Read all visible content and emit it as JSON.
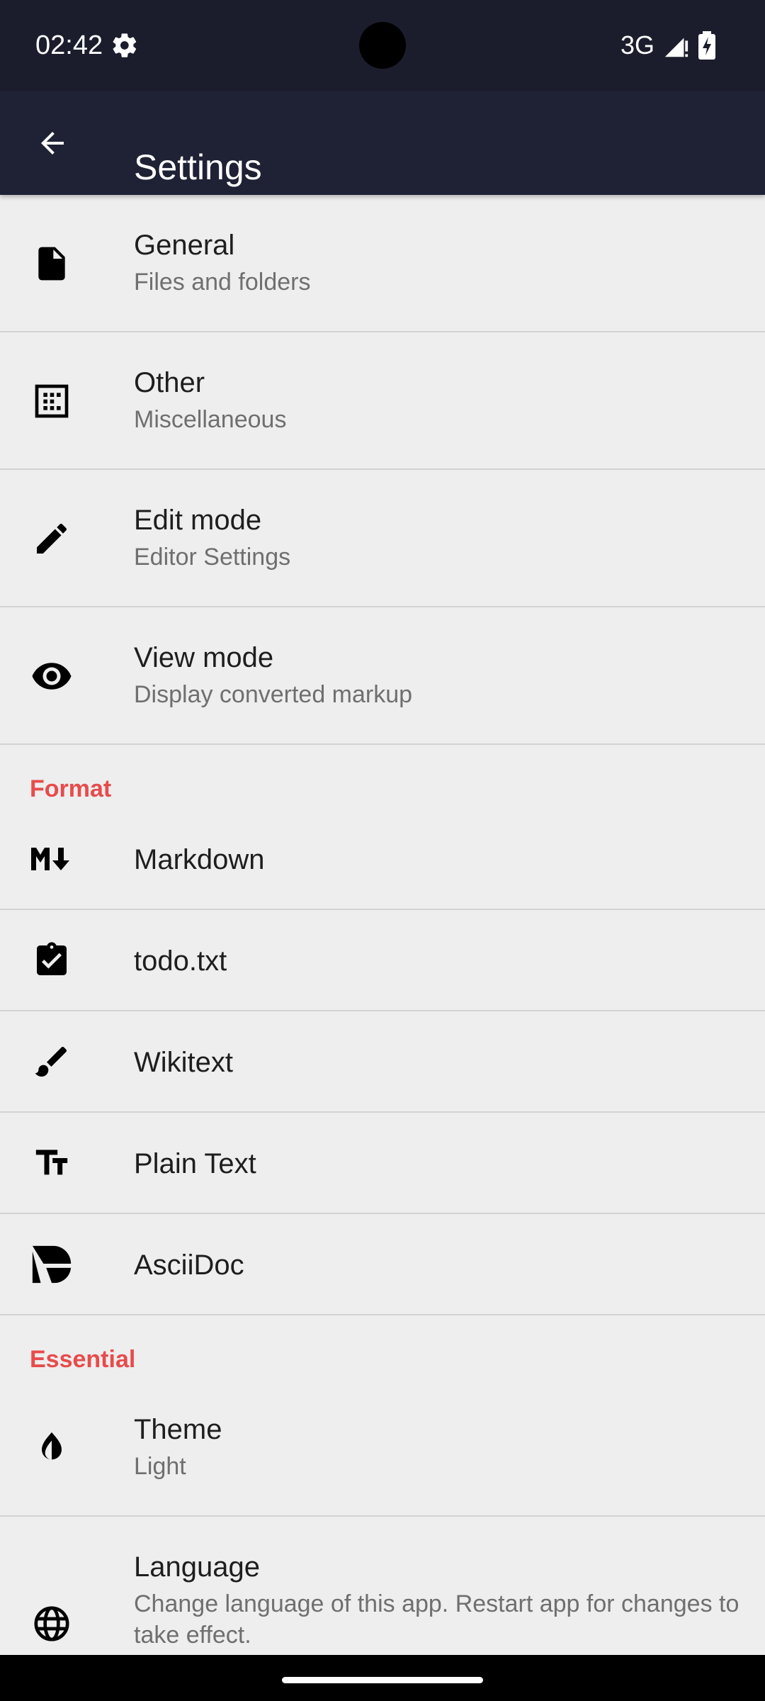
{
  "status_bar": {
    "time": "02:42",
    "network": "3G",
    "icons": [
      "settings-gear-icon",
      "signal-icon",
      "battery-charging-icon"
    ]
  },
  "app_bar": {
    "title": "Settings",
    "back_icon": "arrow-back-icon"
  },
  "items": [
    {
      "icon": "file-icon",
      "title": "General",
      "subtitle": "Files and folders"
    },
    {
      "icon": "dotted-square-icon",
      "title": "Other",
      "subtitle": "Miscellaneous"
    },
    {
      "icon": "pencil-icon",
      "title": "Edit mode",
      "subtitle": "Editor Settings"
    },
    {
      "icon": "eye-icon",
      "title": "View mode",
      "subtitle": "Display converted markup"
    }
  ],
  "sections": {
    "format": {
      "header": "Format",
      "items": [
        {
          "icon": "markdown-icon",
          "title": "Markdown"
        },
        {
          "icon": "clipboard-check-icon",
          "title": "todo.txt"
        },
        {
          "icon": "brush-icon",
          "title": "Wikitext"
        },
        {
          "icon": "text-size-icon",
          "title": "Plain Text"
        },
        {
          "icon": "asciidoc-icon",
          "title": "AsciiDoc"
        }
      ]
    },
    "essential": {
      "header": "Essential",
      "items": [
        {
          "icon": "contrast-icon",
          "title": "Theme",
          "subtitle": "Light"
        },
        {
          "icon": "globe-icon",
          "title": "Language",
          "subtitle": "Change language of this app. Restart app for changes to take effect."
        }
      ]
    }
  },
  "colors": {
    "status_bar": "#1b1d2d",
    "app_bar": "#1f2235",
    "background": "#eeeeee",
    "section_header": "#e74c4c",
    "divider": "#d3d3d3"
  }
}
